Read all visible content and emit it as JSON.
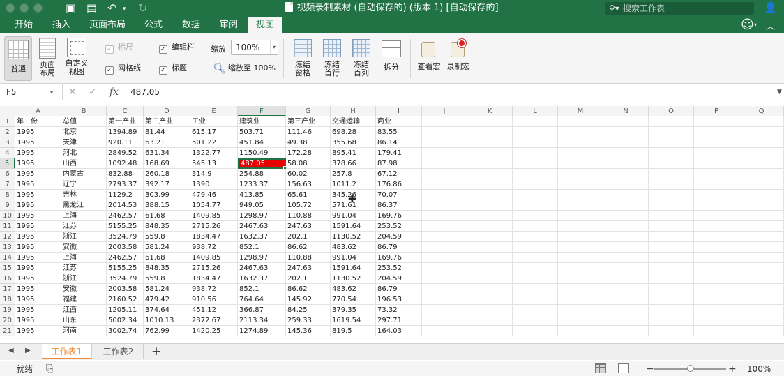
{
  "titlebar": {
    "document_title": "视频录制素材 (自动保存的) (版本 1) [自动保存的]",
    "search_placeholder": "搜索工作表",
    "accent_color": "#217346"
  },
  "ribbon_tabs": [
    {
      "label": "开始",
      "active": false
    },
    {
      "label": "插入",
      "active": false
    },
    {
      "label": "页面布局",
      "active": false
    },
    {
      "label": "公式",
      "active": false
    },
    {
      "label": "数据",
      "active": false
    },
    {
      "label": "审阅",
      "active": false
    },
    {
      "label": "视图",
      "active": true
    }
  ],
  "ribbon": {
    "normal": "普通",
    "page_layout": [
      "页面",
      "布局"
    ],
    "custom_view": [
      "自定义",
      "视图"
    ],
    "ruler": "标尺",
    "formula_bar": "编辑栏",
    "gridlines": "网格线",
    "headings": "标题",
    "zoom_label": "缩放",
    "zoom_value": "100%",
    "zoom_to_100": "缩放至 100%",
    "freeze_panes": [
      "冻结",
      "窗格"
    ],
    "freeze_top_row": [
      "冻结",
      "首行"
    ],
    "freeze_first_col": [
      "冻结",
      "首列"
    ],
    "split": "拆分",
    "view_macros": "查看宏",
    "record_macro": "录制宏"
  },
  "formula_bar": {
    "name_box": "F5",
    "formula": "487.05"
  },
  "grid": {
    "columns": [
      "A",
      "B",
      "C",
      "D",
      "E",
      "F",
      "G",
      "H",
      "I",
      "J",
      "K",
      "L",
      "M",
      "N",
      "O",
      "P",
      "Q"
    ],
    "selected_col": "F",
    "selected_row": 5,
    "rows": [
      {
        "n": "1",
        "cells": [
          "年　份",
          "总值",
          "第一产业",
          "第二产业",
          "工业",
          "建筑业",
          "第三产业",
          "交通运输",
          "商业"
        ]
      },
      {
        "n": "2",
        "cells": [
          "1995",
          "北京",
          "1394.89",
          "81.44",
          "615.17",
          "503.71",
          "111.46",
          "698.28",
          "83.55"
        ]
      },
      {
        "n": "3",
        "cells": [
          "1995",
          "天津",
          "920.11",
          "63.21",
          "501.22",
          "451.84",
          "49.38",
          "355.68",
          "86.14"
        ]
      },
      {
        "n": "4",
        "cells": [
          "1995",
          "河北",
          "2849.52",
          "631.34",
          "1322.77",
          "1150.49",
          "172.28",
          "895.41",
          "179.41"
        ]
      },
      {
        "n": "5",
        "cells": [
          "1995",
          "山西",
          "1092.48",
          "168.69",
          "545.13",
          "487.05",
          "58.08",
          "378.66",
          "87.98"
        ]
      },
      {
        "n": "6",
        "cells": [
          "1995",
          "内蒙古",
          "832.88",
          "260.18",
          "314.9",
          "254.88",
          "60.02",
          "257.8",
          "67.12"
        ]
      },
      {
        "n": "7",
        "cells": [
          "1995",
          "辽宁",
          "2793.37",
          "392.17",
          "1390",
          "1233.37",
          "156.63",
          "1011.2",
          "176.86"
        ]
      },
      {
        "n": "8",
        "cells": [
          "1995",
          "吉林",
          "1129.2",
          "303.99",
          "479.46",
          "413.85",
          "65.61",
          "345.26",
          "70.07"
        ]
      },
      {
        "n": "9",
        "cells": [
          "1995",
          "黑龙江",
          "2014.53",
          "388.15",
          "1054.77",
          "949.05",
          "105.72",
          "571.61",
          "86.37"
        ]
      },
      {
        "n": "10",
        "cells": [
          "1995",
          "上海",
          "2462.57",
          "61.68",
          "1409.85",
          "1298.97",
          "110.88",
          "991.04",
          "169.76"
        ]
      },
      {
        "n": "11",
        "cells": [
          "1995",
          "江苏",
          "5155.25",
          "848.35",
          "2715.26",
          "2467.63",
          "247.63",
          "1591.64",
          "253.52"
        ]
      },
      {
        "n": "12",
        "cells": [
          "1995",
          "浙江",
          "3524.79",
          "559.8",
          "1834.47",
          "1632.37",
          "202.1",
          "1130.52",
          "204.59"
        ]
      },
      {
        "n": "13",
        "cells": [
          "1995",
          "安徽",
          "2003.58",
          "581.24",
          "938.72",
          "852.1",
          "86.62",
          "483.62",
          "86.79"
        ]
      },
      {
        "n": "14",
        "cells": [
          "1995",
          "上海",
          "2462.57",
          "61.68",
          "1409.85",
          "1298.97",
          "110.88",
          "991.04",
          "169.76"
        ]
      },
      {
        "n": "15",
        "cells": [
          "1995",
          "江苏",
          "5155.25",
          "848.35",
          "2715.26",
          "2467.63",
          "247.63",
          "1591.64",
          "253.52"
        ]
      },
      {
        "n": "16",
        "cells": [
          "1995",
          "浙江",
          "3524.79",
          "559.8",
          "1834.47",
          "1632.37",
          "202.1",
          "1130.52",
          "204.59"
        ]
      },
      {
        "n": "17",
        "cells": [
          "1995",
          "安徽",
          "2003.58",
          "581.24",
          "938.72",
          "852.1",
          "86.62",
          "483.62",
          "86.79"
        ]
      },
      {
        "n": "18",
        "cells": [
          "1995",
          "福建",
          "2160.52",
          "479.42",
          "910.56",
          "764.64",
          "145.92",
          "770.54",
          "196.53"
        ]
      },
      {
        "n": "19",
        "cells": [
          "1995",
          "江西",
          "1205.11",
          "374.64",
          "451.12",
          "366.87",
          "84.25",
          "379.35",
          "73.32"
        ]
      },
      {
        "n": "20",
        "cells": [
          "1995",
          "山东",
          "5002.34",
          "1010.13",
          "2372.67",
          "2113.34",
          "259.33",
          "1619.54",
          "297.71"
        ]
      },
      {
        "n": "21",
        "cells": [
          "1995",
          "河南",
          "3002.74",
          "762.99",
          "1420.25",
          "1274.89",
          "145.36",
          "819.5",
          "164.03"
        ]
      }
    ]
  },
  "sheets": [
    {
      "label": "工作表1",
      "active": true
    },
    {
      "label": "工作表2",
      "active": false
    }
  ],
  "status": {
    "text": "就绪",
    "zoom": "100%",
    "zoom_level": 0.5
  }
}
